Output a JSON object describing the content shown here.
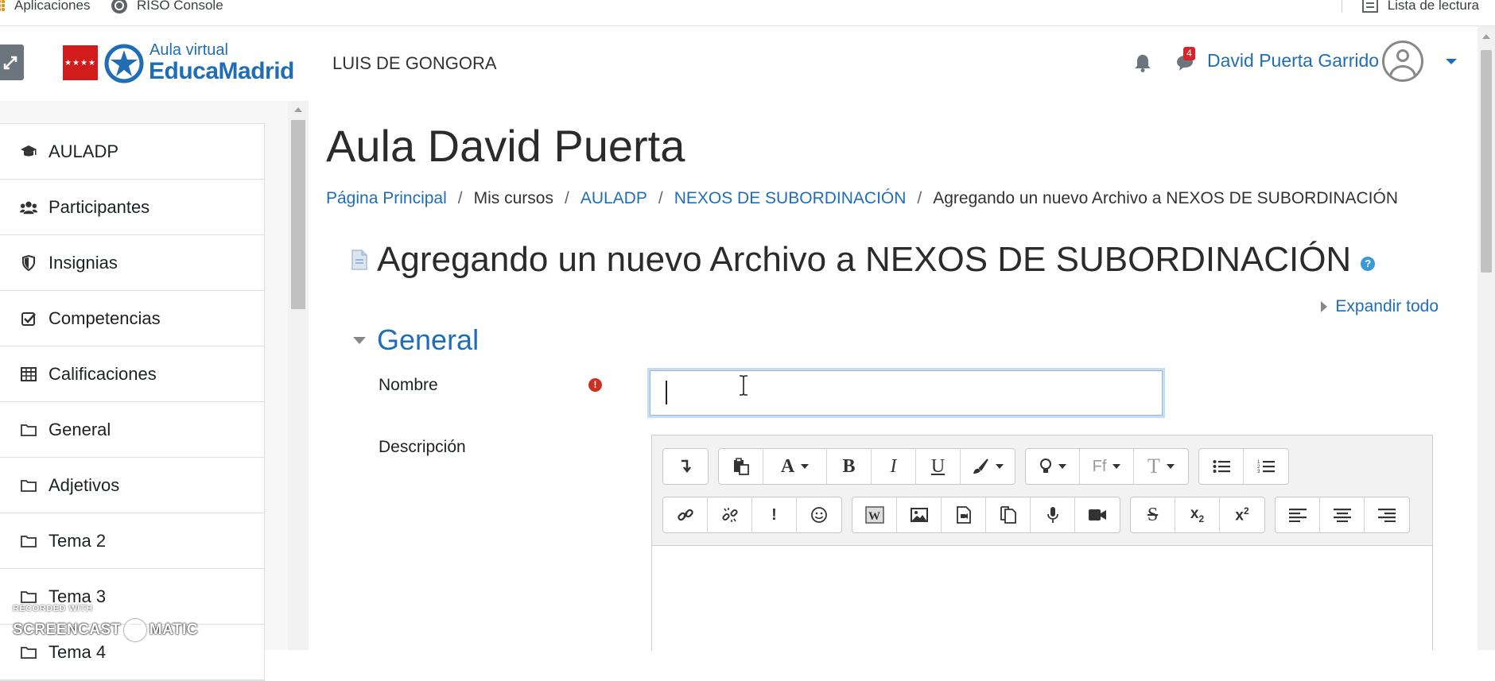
{
  "bookmarks": {
    "apps": "Aplicaciones",
    "riso": "RISO Console",
    "reading_list": "Lista de lectura"
  },
  "navbar": {
    "logo_small": "Aula virtual",
    "logo_big": "EducaMadrid",
    "site_name": "LUIS DE GONGORA",
    "notification_count": "4",
    "user_name": "David Puerta Garrido"
  },
  "sidebar": {
    "items": [
      {
        "label": "AULADP",
        "icon": "graduation-cap-icon"
      },
      {
        "label": "Participantes",
        "icon": "users-icon"
      },
      {
        "label": "Insignias",
        "icon": "shield-icon"
      },
      {
        "label": "Competencias",
        "icon": "checkbox-icon"
      },
      {
        "label": "Calificaciones",
        "icon": "table-icon"
      },
      {
        "label": "General",
        "icon": "folder-icon"
      },
      {
        "label": "Adjetivos",
        "icon": "folder-icon"
      },
      {
        "label": "Tema 2",
        "icon": "folder-icon"
      },
      {
        "label": "Tema 3",
        "icon": "folder-icon"
      },
      {
        "label": "Tema 4",
        "icon": "folder-icon"
      }
    ]
  },
  "main": {
    "course_title": "Aula David Puerta",
    "breadcrumb": [
      {
        "label": "Página Principal",
        "link": true
      },
      {
        "label": "Mis cursos",
        "link": false
      },
      {
        "label": "AULADP",
        "link": true
      },
      {
        "label": "NEXOS DE SUBORDINACIÓN",
        "link": true
      },
      {
        "label": "Agregando un nuevo Archivo a NEXOS DE SUBORDINACIÓN",
        "link": false
      }
    ],
    "breadcrumb_sep": "/",
    "page_heading": "Agregando un nuevo Archivo a NEXOS DE SUBORDINACIÓN",
    "help_glyph": "?",
    "expand_all": "Expandir todo",
    "section_title": "General",
    "nombre_label": "Nombre",
    "nombre_value": "",
    "required_glyph": "!",
    "descripcion_label": "Descripción"
  },
  "editor": {
    "font_size_label": "Ff"
  },
  "watermark": {
    "small": "RECORDED WITH",
    "big_left": "SCREENCAST",
    "big_right": "MATIC"
  }
}
